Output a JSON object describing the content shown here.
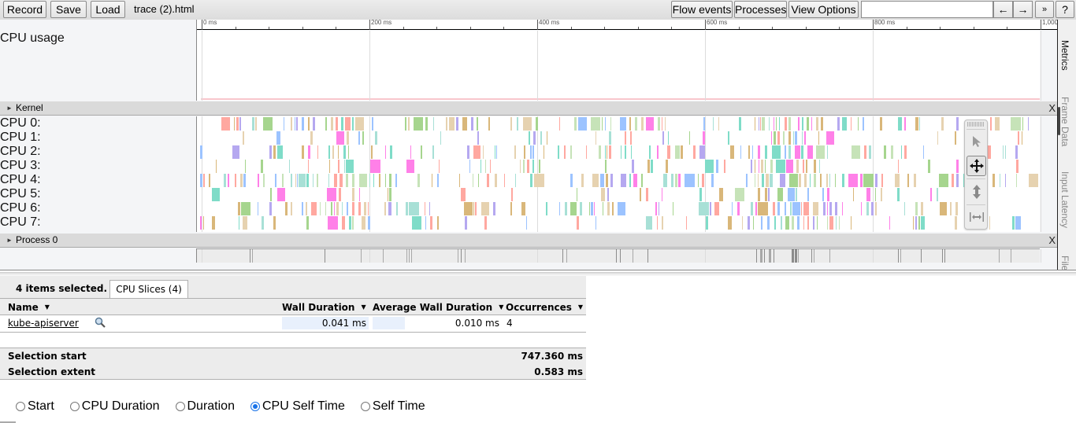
{
  "toolbar": {
    "record_label": "Record",
    "save_label": "Save",
    "load_label": "Load",
    "file_title": "trace (2).html",
    "flow_events_label": "Flow events",
    "processes_label": "Processes",
    "view_options_label": "View Options",
    "search_value": "",
    "prev_label": "←",
    "next_label": "→",
    "more_label": "»",
    "help_label": "?"
  },
  "ruler": {
    "labels": [
      "0 ms",
      "200 ms",
      "400 ms",
      "600 ms",
      "800 ms",
      "1,000"
    ],
    "range_ms": [
      0,
      1000
    ]
  },
  "tracks": {
    "cpu_usage_label": "CPU usage",
    "kernel_group": "Kernel",
    "process_group": "Process 0",
    "close_label": "X",
    "cpus": [
      "CPU 0:",
      "CPU 1:",
      "CPU 2:",
      "CPU 3:",
      "CPU 4:",
      "CPU 5:",
      "CPU 6:",
      "CPU 7:"
    ],
    "slice_colors": [
      "#7fdcc8",
      "#a8e0d6",
      "#b5a8f0",
      "#a6d58e",
      "#ff80e8",
      "#d9b77a",
      "#9cc3ff",
      "#c6e3b8",
      "#ffa8a0",
      "#e6d2b0"
    ]
  },
  "mouse_modes": [
    "selection",
    "pan",
    "zoom",
    "timing"
  ],
  "side_tabs": [
    "Metrics",
    "Frame Data",
    "Input Latency",
    "File"
  ],
  "analysis": {
    "selection_count": "4 items selected.",
    "tab_label": "CPU Slices (4)",
    "columns": {
      "name": "Name",
      "wall_duration": "Wall Duration",
      "avg_wall_duration": "Average Wall Duration",
      "occurrences": "Occurrences"
    },
    "sort_icon": "▼",
    "rows": [
      {
        "name": "kube-apiserver",
        "wall_duration": "0.041 ms",
        "avg_wall_duration": "0.010 ms",
        "occurrences": "4"
      }
    ],
    "selection_start_label": "Selection start",
    "selection_start_value": "747.360 ms",
    "selection_extent_label": "Selection extent",
    "selection_extent_value": "0.583 ms"
  },
  "radio_options": [
    {
      "label": "Start",
      "checked": false
    },
    {
      "label": "CPU Duration",
      "checked": false
    },
    {
      "label": "Duration",
      "checked": false
    },
    {
      "label": "CPU Self Time",
      "checked": true
    },
    {
      "label": "Self Time",
      "checked": false
    }
  ]
}
